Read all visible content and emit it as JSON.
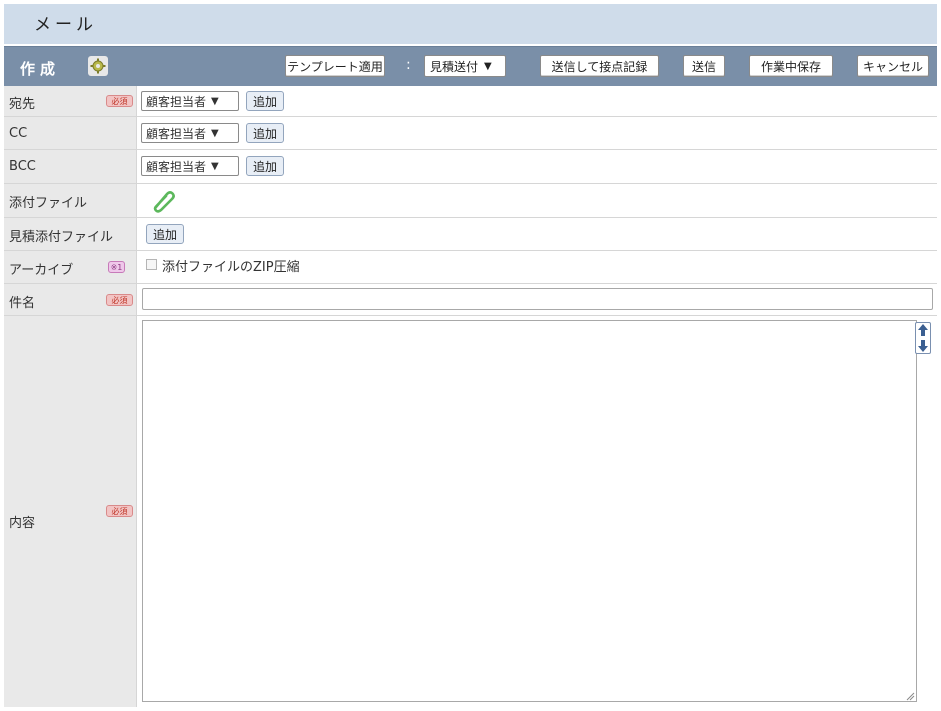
{
  "window": {
    "title": "メール"
  },
  "toolbar": {
    "mode_label": "作成",
    "mode_icon": "gear-icon",
    "template_button": "テンプレート適用",
    "colon": ":",
    "template_select": "見積送付",
    "send_and_record_button": "送信して接点記録",
    "send_button": "送信",
    "save_draft_button": "作業中保存",
    "cancel_button": "キャンセル"
  },
  "form": {
    "to": {
      "label": "宛先",
      "badge": "必須",
      "select": "顧客担当者",
      "add_button": "追加"
    },
    "cc": {
      "label": "CC",
      "select": "顧客担当者",
      "add_button": "追加"
    },
    "bcc": {
      "label": "BCC",
      "select": "顧客担当者",
      "add_button": "追加"
    },
    "attachment": {
      "label": "添付ファイル",
      "icon": "paperclip-icon"
    },
    "estimate_attachment": {
      "label": "見積添付ファイル",
      "add_button": "追加"
    },
    "archive": {
      "label": "アーカイブ",
      "badge": "※1",
      "checkbox_label": "添付ファイルのZIP圧縮",
      "checked": false
    },
    "subject": {
      "label": "件名",
      "badge": "必須",
      "value": ""
    },
    "body": {
      "label": "内容",
      "badge": "必須",
      "value": ""
    }
  },
  "colors": {
    "title_bar": "#cfdcea",
    "toolbar": "#7a8fa8",
    "label_bg": "#e9e9e9",
    "required_badge": "#f2c4c4",
    "paperclip": "#5cb85c"
  }
}
